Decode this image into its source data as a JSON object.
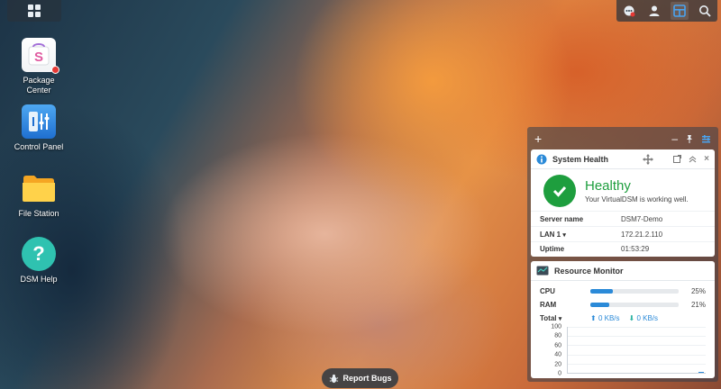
{
  "desktop": {
    "icons": [
      {
        "label": "Package\nCenter",
        "name": "package-center"
      },
      {
        "label": "Control Panel",
        "name": "control-panel"
      },
      {
        "label": "File Station",
        "name": "file-station"
      },
      {
        "label": "DSM Help",
        "name": "dsm-help"
      }
    ],
    "report_bugs": "Report Bugs"
  },
  "tray": {
    "icons": [
      "notification-icon",
      "user-icon",
      "widgets-icon",
      "search-icon"
    ]
  },
  "widgets": {
    "system_health": {
      "title": "System Health",
      "status": "Healthy",
      "message": "Your VirtualDSM is working well.",
      "rows": [
        {
          "key": "Server name",
          "value": "DSM7-Demo"
        },
        {
          "key": "LAN 1",
          "value": "172.21.2.110"
        },
        {
          "key": "Uptime",
          "value": "01:53:29"
        }
      ]
    },
    "resource_monitor": {
      "title": "Resource Monitor",
      "cpu_label": "CPU",
      "cpu_value": 25,
      "cpu_text": "25%",
      "ram_label": "RAM",
      "ram_value": 21,
      "ram_text": "21%",
      "total_label": "Total",
      "upload": "0 KB/s",
      "download": "0 KB/s",
      "y_ticks": [
        "100",
        "80",
        "60",
        "40",
        "20",
        "0"
      ]
    }
  },
  "colors": {
    "accent": "#2b8ad8",
    "healthy": "#1e9e3e",
    "badge": "#e53935"
  }
}
